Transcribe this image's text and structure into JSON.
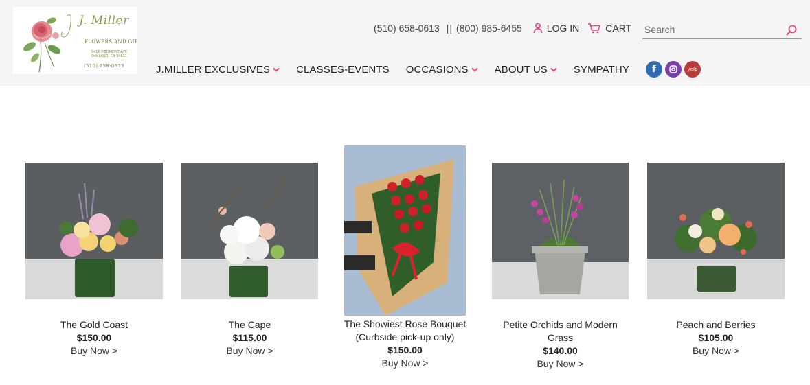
{
  "brand": {
    "logo_script": "J. Miller",
    "logo_tagline": "FLOWERS AND GIFTS",
    "logo_address": "5416 PIEDMONT AVE\nOAKLAND, CA 94611",
    "logo_phone": "(510) 658-0613"
  },
  "topbar": {
    "phone_local": "(510) 658-0613",
    "separator": "||",
    "phone_tollfree": "(800) 985-6455",
    "login_label": "LOG IN",
    "cart_label": "CART"
  },
  "search": {
    "placeholder": "Search",
    "value": ""
  },
  "nav": {
    "items": [
      {
        "label": "J.MILLER EXCLUSIVES",
        "dropdown": true
      },
      {
        "label": "CLASSES-EVENTS",
        "dropdown": false
      },
      {
        "label": "OCCASIONS",
        "dropdown": true
      },
      {
        "label": "ABOUT US",
        "dropdown": true
      },
      {
        "label": "SYMPATHY",
        "dropdown": false
      }
    ],
    "social": [
      {
        "icon": "facebook-icon",
        "glyph": "f",
        "color": "#2d6bb5"
      },
      {
        "icon": "instagram-icon",
        "glyph": "◙",
        "color": "#7b3fa8"
      },
      {
        "icon": "yelp-icon",
        "glyph": "yelp",
        "color": "#b83a36"
      }
    ]
  },
  "colors": {
    "accent": "#e2457a",
    "header_bg": "#f5f5f5"
  },
  "products": [
    {
      "name": "The Gold Coast",
      "price": "$150.00",
      "buy": "Buy Now >"
    },
    {
      "name": "The Cape",
      "price": "$115.00",
      "buy": "Buy Now >"
    },
    {
      "name": "The Showiest Rose Bouquet (Curbside pick-up only)",
      "price": "$150.00",
      "buy": "Buy Now >"
    },
    {
      "name": "Petite Orchids and Modern Grass",
      "price": "$140.00",
      "buy": "Buy Now >"
    },
    {
      "name": "Peach and Berries",
      "price": "$105.00",
      "buy": "Buy Now >"
    }
  ]
}
